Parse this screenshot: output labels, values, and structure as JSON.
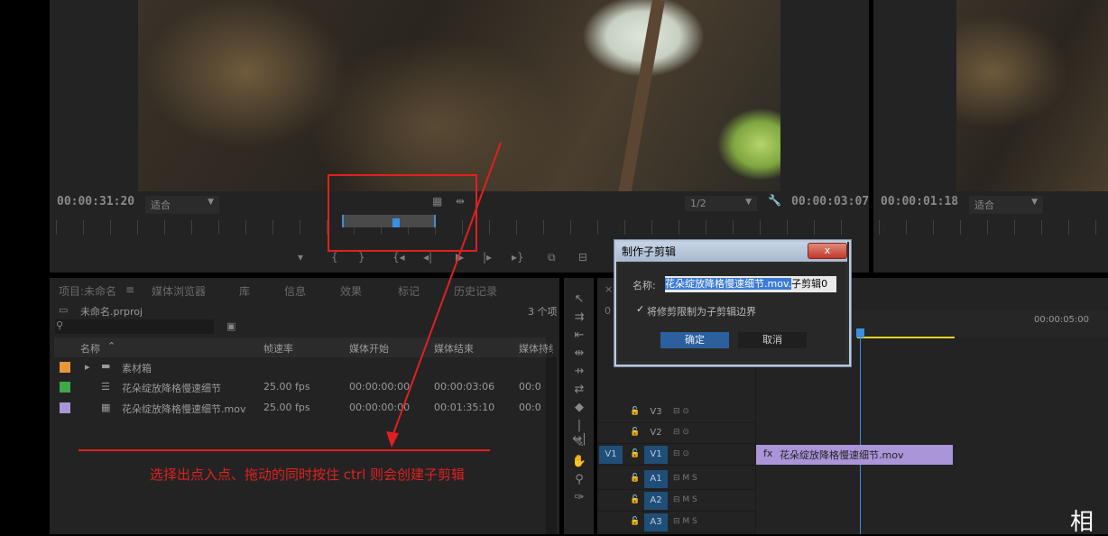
{
  "source_monitor": {
    "timecode_left": "00:00:31:20",
    "fit_label": "适合",
    "resolution": "1/2",
    "timecode_right": "00:00:03:07",
    "transport_icons": [
      "marker-icon",
      "mark-in-icon",
      "mark-out-icon",
      "go-to-in-icon",
      "step-back-icon",
      "play-icon",
      "step-forward-icon",
      "go-to-out-icon",
      "insert-icon",
      "overwrite-icon",
      "export-frame-icon"
    ]
  },
  "program_monitor": {
    "timecode_left": "00:00:01:18",
    "fit_label": "适合"
  },
  "project_panel": {
    "tabs": [
      "项目:未命名",
      "媒体浏览器",
      "库",
      "信息",
      "效果",
      "标记",
      "历史记录"
    ],
    "project_file": "未命名.prproj",
    "item_count": "3 个项",
    "columns": [
      "名称",
      "帧速率",
      "媒体开始",
      "媒体结束",
      "媒体持续"
    ],
    "rows": [
      {
        "color": "#e8963a",
        "name": "素材箱",
        "fps": "",
        "start": "",
        "end": "",
        "dur": "",
        "type": "bin"
      },
      {
        "color": "#3fa84a",
        "name": "花朵绽放降格慢速细节",
        "fps": "25.00 fps",
        "start": "00:00:00:00",
        "end": "00:00:03:06",
        "dur": "00:0",
        "type": "subclip"
      },
      {
        "color": "#a995d8",
        "name": "花朵绽放降格慢速细节.mov",
        "fps": "25.00 fps",
        "start": "00:00:00:00",
        "end": "00:01:35:10",
        "dur": "00:0",
        "type": "clip"
      }
    ]
  },
  "timeline": {
    "ruler_time": "00:00:05:00",
    "tracks": [
      {
        "name": "V3",
        "active": false,
        "icons": "⊟ ⊙"
      },
      {
        "name": "V2",
        "active": false,
        "icons": "⊟ ⊙"
      },
      {
        "name": "V1",
        "active": true,
        "icons": "⊟ ⊙",
        "source": "V1"
      },
      {
        "name": "A1",
        "active": true,
        "icons": "⊟ M S"
      },
      {
        "name": "A2",
        "active": true,
        "icons": "⊟ M S"
      },
      {
        "name": "A3",
        "active": true,
        "icons": "⊟ M S"
      }
    ],
    "clip_label": "花朵绽放降格慢速细节.mov"
  },
  "dialog": {
    "title": "制作子剪辑",
    "close": "x",
    "name_label": "名称:",
    "name_selected": "花朵绽放降格慢速细节.mov.",
    "name_rest": "子剪辑0",
    "checkbox_label": "将修剪限制为子剪辑边界",
    "checkbox_mark": "✓",
    "ok": "确定",
    "cancel": "取消"
  },
  "annotation": {
    "text": "选择出点入点、拖动的同时按住 ctrl 则会创建子剪辑",
    "color": "#e02020"
  },
  "corner_text": "相"
}
